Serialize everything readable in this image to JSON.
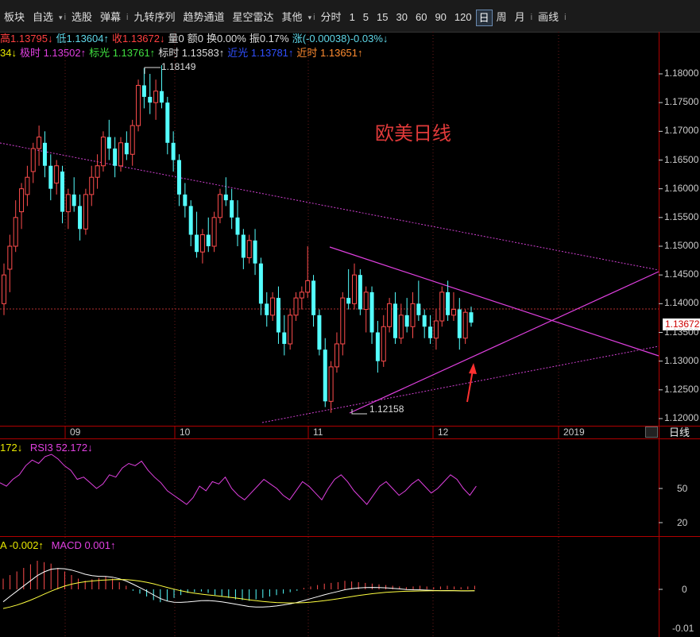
{
  "toolbar": {
    "items": [
      {
        "label": "板块",
        "type": "menu"
      },
      {
        "label": "自选",
        "type": "dropdown"
      },
      {
        "label": "i",
        "type": "sep"
      },
      {
        "label": "选股",
        "type": "menu"
      },
      {
        "label": "弹幕",
        "type": "menu"
      },
      {
        "label": "i",
        "type": "sep"
      },
      {
        "label": "九转序列",
        "type": "menu"
      },
      {
        "label": "趋势通道",
        "type": "menu"
      },
      {
        "label": "星空雷达",
        "type": "menu"
      },
      {
        "label": "其他",
        "type": "dropdown"
      },
      {
        "label": "i",
        "type": "sep"
      },
      {
        "label": "分时",
        "type": "menu"
      },
      {
        "label": "1",
        "type": "menu"
      },
      {
        "label": "5",
        "type": "menu"
      },
      {
        "label": "15",
        "type": "menu"
      },
      {
        "label": "30",
        "type": "menu"
      },
      {
        "label": "60",
        "type": "menu"
      },
      {
        "label": "90",
        "type": "menu"
      },
      {
        "label": "120",
        "type": "menu"
      },
      {
        "label": "日",
        "type": "active"
      },
      {
        "label": "周",
        "type": "menu"
      },
      {
        "label": "月",
        "type": "menu"
      },
      {
        "label": "i",
        "type": "sep"
      },
      {
        "label": "画线",
        "type": "menu"
      },
      {
        "label": "i",
        "type": "sep"
      }
    ]
  },
  "info1": [
    {
      "text": "高1.13795↓",
      "color": "#ff4040"
    },
    {
      "text": "低1.13604↑",
      "color": "#5fd7e8"
    },
    {
      "text": "收1.13672↓",
      "color": "#ff4040"
    },
    {
      "text": "量0",
      "color": "#dddddd"
    },
    {
      "text": "额0",
      "color": "#dddddd"
    },
    {
      "text": "换0.00%",
      "color": "#dddddd"
    },
    {
      "text": "振0.17%",
      "color": "#dddddd"
    },
    {
      "text": "涨(-0.00038)-0.03%↓",
      "color": "#5fd7e8"
    }
  ],
  "info2": [
    {
      "text": "34↓",
      "color": "#e8e800"
    },
    {
      "text": "极时 1.13502↑",
      "color": "#e040e0"
    },
    {
      "text": "标光 1.13761↑",
      "color": "#40e040"
    },
    {
      "text": "标时 1.13583↑",
      "color": "#dddddd"
    },
    {
      "text": "近光 1.13781↑",
      "color": "#3050ff"
    },
    {
      "text": "近时 1.13651↑",
      "color": "#ff8c30"
    }
  ],
  "chart_title": "欧美日线",
  "price_tag": "1.13672",
  "annotations": {
    "high": "1.18149",
    "low": "1.12158"
  },
  "yaxis": [
    "1.18000",
    "1.17500",
    "1.17000",
    "1.16500",
    "1.16000",
    "1.15500",
    "1.15000",
    "1.14500",
    "1.14000",
    "1.13500",
    "1.13000",
    "1.12500",
    "1.12000"
  ],
  "xaxis": [
    "09",
    "10",
    "11",
    "12",
    "2019"
  ],
  "period_label": "日线",
  "rsi_label_a": "172↓",
  "rsi_label_b": "RSI3 52.172↓",
  "rsi_ticks": [
    "50",
    "20"
  ],
  "macd_label_a": "A -0.002↑",
  "macd_label_b": "MACD 0.001↑",
  "macd_ticks": [
    "0",
    "-0.01"
  ],
  "colors": {
    "up": "#ff4d4d",
    "down": "#54ffff",
    "trend": "#e040e0",
    "rsi": "#e040e0",
    "dif": "#ffffff",
    "dea": "#ffff40"
  },
  "chart_data": [
    {
      "type": "candlestick",
      "title": "欧美日线",
      "ylim": [
        1.118,
        1.1835
      ],
      "x_ticks": [
        "09",
        "10",
        "11",
        "12",
        "2019"
      ],
      "candles": [
        [
          1.14,
          1.147,
          1.138,
          1.145
        ],
        [
          1.146,
          1.152,
          1.142,
          1.15
        ],
        [
          1.15,
          1.158,
          1.149,
          1.155
        ],
        [
          1.156,
          1.161,
          1.153,
          1.16
        ],
        [
          1.159,
          1.164,
          1.157,
          1.162
        ],
        [
          1.163,
          1.168,
          1.161,
          1.167
        ],
        [
          1.167,
          1.171,
          1.164,
          1.169
        ],
        [
          1.168,
          1.17,
          1.162,
          1.164
        ],
        [
          1.164,
          1.166,
          1.158,
          1.16
        ],
        [
          1.161,
          1.165,
          1.159,
          1.164
        ],
        [
          1.163,
          1.164,
          1.154,
          1.156
        ],
        [
          1.156,
          1.16,
          1.153,
          1.159
        ],
        [
          1.159,
          1.162,
          1.156,
          1.157
        ],
        [
          1.157,
          1.159,
          1.151,
          1.153
        ],
        [
          1.153,
          1.16,
          1.152,
          1.159
        ],
        [
          1.159,
          1.164,
          1.157,
          1.162
        ],
        [
          1.162,
          1.166,
          1.16,
          1.164
        ],
        [
          1.164,
          1.17,
          1.163,
          1.169
        ],
        [
          1.169,
          1.172,
          1.165,
          1.167
        ],
        [
          1.167,
          1.169,
          1.162,
          1.164
        ],
        [
          1.164,
          1.169,
          1.163,
          1.168
        ],
        [
          1.168,
          1.17,
          1.165,
          1.166
        ],
        [
          1.166,
          1.172,
          1.164,
          1.171
        ],
        [
          1.171,
          1.179,
          1.17,
          1.178
        ],
        [
          1.178,
          1.181,
          1.174,
          1.176
        ],
        [
          1.176,
          1.18,
          1.173,
          1.175
        ],
        [
          1.175,
          1.179,
          1.172,
          1.177
        ],
        [
          1.177,
          1.1815,
          1.174,
          1.175
        ],
        [
          1.175,
          1.176,
          1.166,
          1.168
        ],
        [
          1.168,
          1.17,
          1.163,
          1.165
        ],
        [
          1.165,
          1.166,
          1.157,
          1.159
        ],
        [
          1.159,
          1.161,
          1.155,
          1.157
        ],
        [
          1.157,
          1.158,
          1.15,
          1.152
        ],
        [
          1.152,
          1.156,
          1.148,
          1.149
        ],
        [
          1.149,
          1.153,
          1.147,
          1.152
        ],
        [
          1.152,
          1.155,
          1.149,
          1.15
        ],
        [
          1.15,
          1.156,
          1.149,
          1.155
        ],
        [
          1.155,
          1.16,
          1.154,
          1.159
        ],
        [
          1.159,
          1.162,
          1.157,
          1.158
        ],
        [
          1.158,
          1.16,
          1.153,
          1.155
        ],
        [
          1.155,
          1.158,
          1.15,
          1.152
        ],
        [
          1.152,
          1.153,
          1.146,
          1.148
        ],
        [
          1.148,
          1.152,
          1.147,
          1.151
        ],
        [
          1.151,
          1.153,
          1.145,
          1.147
        ],
        [
          1.147,
          1.148,
          1.138,
          1.14
        ],
        [
          1.14,
          1.142,
          1.136,
          1.138
        ],
        [
          1.138,
          1.142,
          1.137,
          1.141
        ],
        [
          1.141,
          1.143,
          1.133,
          1.135
        ],
        [
          1.135,
          1.138,
          1.131,
          1.133
        ],
        [
          1.133,
          1.139,
          1.132,
          1.138
        ],
        [
          1.138,
          1.142,
          1.137,
          1.141
        ],
        [
          1.141,
          1.143,
          1.139,
          1.142
        ],
        [
          1.142,
          1.15,
          1.141,
          1.144
        ],
        [
          1.144,
          1.145,
          1.136,
          1.138
        ],
        [
          1.138,
          1.139,
          1.131,
          1.132
        ],
        [
          1.132,
          1.134,
          1.122,
          1.123
        ],
        [
          1.123,
          1.13,
          1.121,
          1.129
        ],
        [
          1.129,
          1.135,
          1.128,
          1.133
        ],
        [
          1.133,
          1.142,
          1.131,
          1.141
        ],
        [
          1.141,
          1.146,
          1.139,
          1.14
        ],
        [
          1.14,
          1.147,
          1.139,
          1.145
        ],
        [
          1.145,
          1.146,
          1.138,
          1.139
        ],
        [
          1.139,
          1.143,
          1.135,
          1.142
        ],
        [
          1.142,
          1.143,
          1.133,
          1.135
        ],
        [
          1.135,
          1.137,
          1.128,
          1.13
        ],
        [
          1.13,
          1.138,
          1.129,
          1.136
        ],
        [
          1.136,
          1.141,
          1.135,
          1.14
        ],
        [
          1.14,
          1.142,
          1.133,
          1.134
        ],
        [
          1.134,
          1.14,
          1.133,
          1.138
        ],
        [
          1.138,
          1.141,
          1.135,
          1.136
        ],
        [
          1.136,
          1.142,
          1.134,
          1.14
        ],
        [
          1.14,
          1.144,
          1.137,
          1.138
        ],
        [
          1.138,
          1.139,
          1.134,
          1.136
        ],
        [
          1.136,
          1.138,
          1.133,
          1.134
        ],
        [
          1.134,
          1.139,
          1.132,
          1.137
        ],
        [
          1.137,
          1.143,
          1.136,
          1.142
        ],
        [
          1.142,
          1.144,
          1.137,
          1.138
        ],
        [
          1.138,
          1.142,
          1.137,
          1.139
        ],
        [
          1.139,
          1.141,
          1.132,
          1.134
        ],
        [
          1.134,
          1.139,
          1.133,
          1.1385
        ],
        [
          1.1385,
          1.1395,
          1.136,
          1.1367
        ]
      ]
    },
    {
      "type": "line",
      "name": "RSI3",
      "ylim": [
        10,
        100
      ],
      "values": [
        55,
        52,
        58,
        62,
        70,
        75,
        72,
        78,
        80,
        76,
        70,
        66,
        58,
        60,
        55,
        50,
        54,
        62,
        60,
        68,
        72,
        70,
        74,
        66,
        60,
        55,
        48,
        44,
        40,
        36,
        42,
        52,
        48,
        56,
        54,
        60,
        50,
        44,
        40,
        46,
        52,
        58,
        54,
        50,
        44,
        40,
        48,
        56,
        52,
        46,
        40,
        50,
        58,
        62,
        56,
        48,
        42,
        36,
        44,
        52,
        56,
        50,
        44,
        48,
        54,
        58,
        52,
        46,
        50,
        56,
        62,
        58,
        50,
        44,
        52
      ]
    },
    {
      "type": "bar",
      "name": "MACD",
      "ylim": [
        -0.011,
        0.006
      ],
      "values": [
        0.0015,
        0.002,
        0.0025,
        0.003,
        0.0035,
        0.004,
        0.0038,
        0.0036,
        0.003,
        0.0025,
        0.002,
        0.0015,
        0.0012,
        0.0014,
        0.0016,
        0.0018,
        0.0015,
        0.001,
        0.0005,
        -0.0002,
        -0.0006,
        -0.001,
        -0.0015,
        -0.0018,
        -0.0016,
        -0.0012,
        -0.0008,
        -0.0005,
        -0.0004,
        -0.0003,
        -0.0005,
        -0.0008,
        -0.001,
        -0.0012,
        -0.0014,
        -0.0015,
        -0.0016,
        -0.0014,
        -0.0012,
        -0.001,
        -0.0008,
        -0.0006,
        -0.0004,
        -0.0002,
        0.0002,
        0.0004,
        0.0006,
        0.0008,
        0.0009,
        0.001,
        0.0012,
        0.0011,
        0.001,
        0.0009,
        0.0008,
        0.0007,
        0.0006,
        0.0005,
        0.0004,
        0.0003,
        0.0004,
        0.0005,
        0.0004,
        0.0003,
        0.0004,
        0.0005,
        0.0004,
        0.0003,
        0.0004,
        0.0005
      ]
    }
  ]
}
